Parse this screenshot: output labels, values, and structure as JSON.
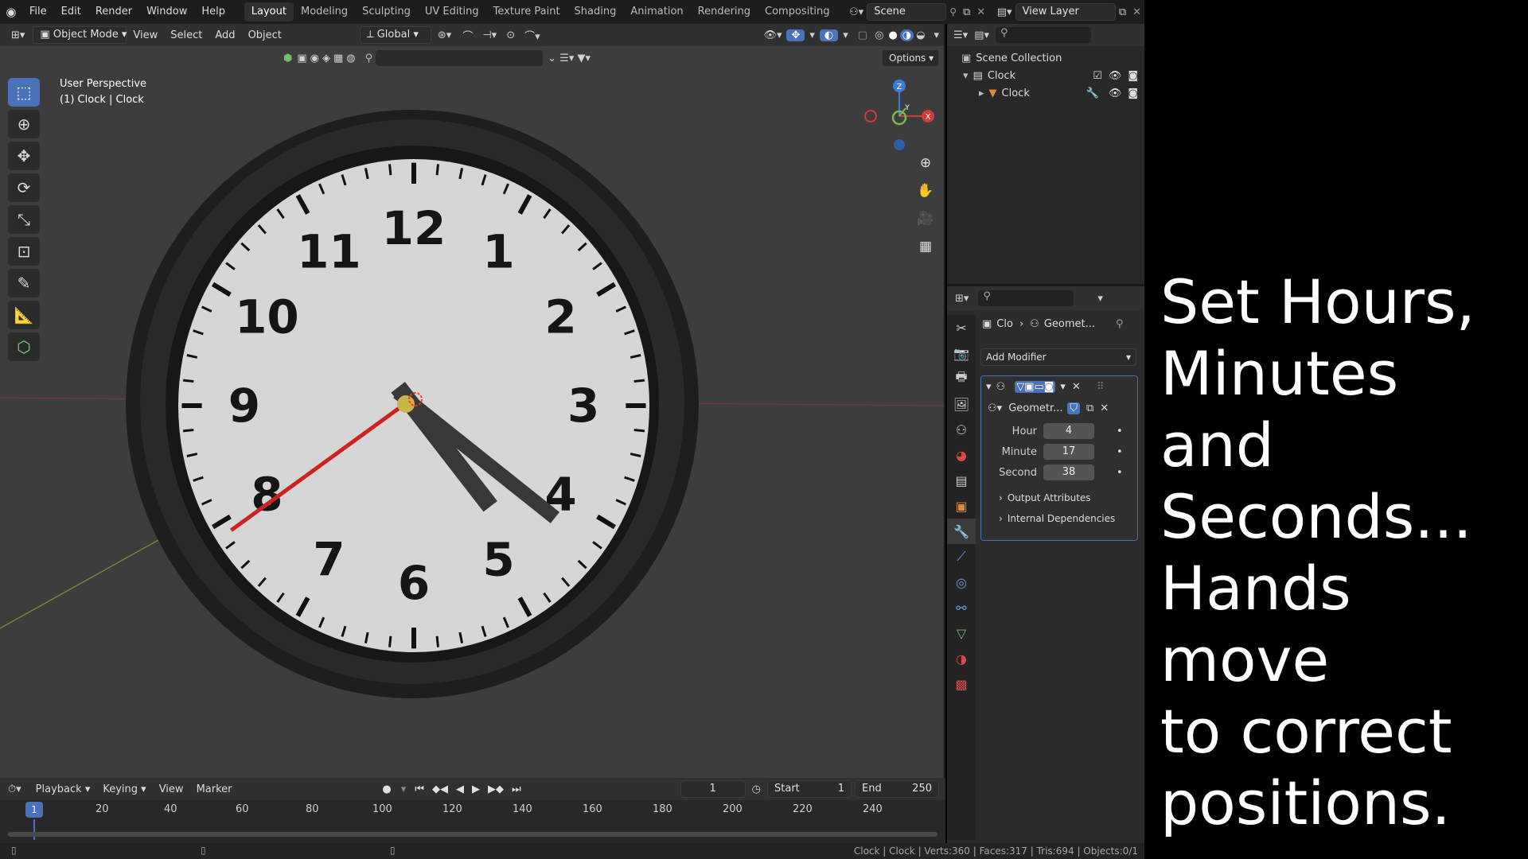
{
  "topbar": {
    "menus": [
      "File",
      "Edit",
      "Render",
      "Window",
      "Help"
    ],
    "workspaces": [
      "Layout",
      "Modeling",
      "Sculpting",
      "UV Editing",
      "Texture Paint",
      "Shading",
      "Animation",
      "Rendering",
      "Compositing"
    ],
    "active_workspace": "Layout",
    "scene": "Scene",
    "view_layer": "View Layer"
  },
  "viewport": {
    "mode": "Object Mode",
    "menus": [
      "View",
      "Select",
      "Add",
      "Object"
    ],
    "transform_orientation": "Global",
    "options_label": "Options",
    "overlay_title": "User Perspective",
    "overlay_subtitle": "(1) Clock | Clock",
    "gizmo_z": "Z",
    "gizmo_y": "Y",
    "gizmo_x": "X"
  },
  "clock": {
    "numbers": [
      "12",
      "1",
      "2",
      "3",
      "4",
      "5",
      "6",
      "7",
      "8",
      "9",
      "10",
      "11"
    ],
    "hour": 4,
    "minute": 17,
    "second": 38,
    "face_color": "#d6d6d6",
    "rim_color": "#202020",
    "hand_color": "#383838",
    "second_hand_color": "#cc2222"
  },
  "timeline": {
    "menus": [
      "Playback",
      "Keying",
      "View",
      "Marker"
    ],
    "current_frame": "1",
    "start_label": "Start",
    "start_value": "1",
    "end_label": "End",
    "end_value": "250",
    "ticks": [
      "20",
      "40",
      "60",
      "80",
      "100",
      "120",
      "140",
      "160",
      "180",
      "200",
      "220",
      "240"
    ],
    "playhead": "1"
  },
  "statusbar": {
    "stats": "Clock | Clock | Verts:360 | Faces:317 | Tris:694 | Objects:0/1"
  },
  "outliner": {
    "root": "Scene Collection",
    "collection": "Clock",
    "object": "Clock"
  },
  "properties": {
    "breadcrumb_object": "Clo",
    "breadcrumb_modifier": "Geomet...",
    "add_modifier": "Add Modifier",
    "node_group": "Geometr...",
    "fields": [
      {
        "label": "Hour",
        "value": "4"
      },
      {
        "label": "Minute",
        "value": "17"
      },
      {
        "label": "Second",
        "value": "38"
      }
    ],
    "output_attributes": "Output Attributes",
    "internal_dependencies": "Internal Dependencies"
  },
  "caption": {
    "text": "Set Hours,\nMinutes and\nSeconds...\nHands move\nto correct\npositions."
  }
}
